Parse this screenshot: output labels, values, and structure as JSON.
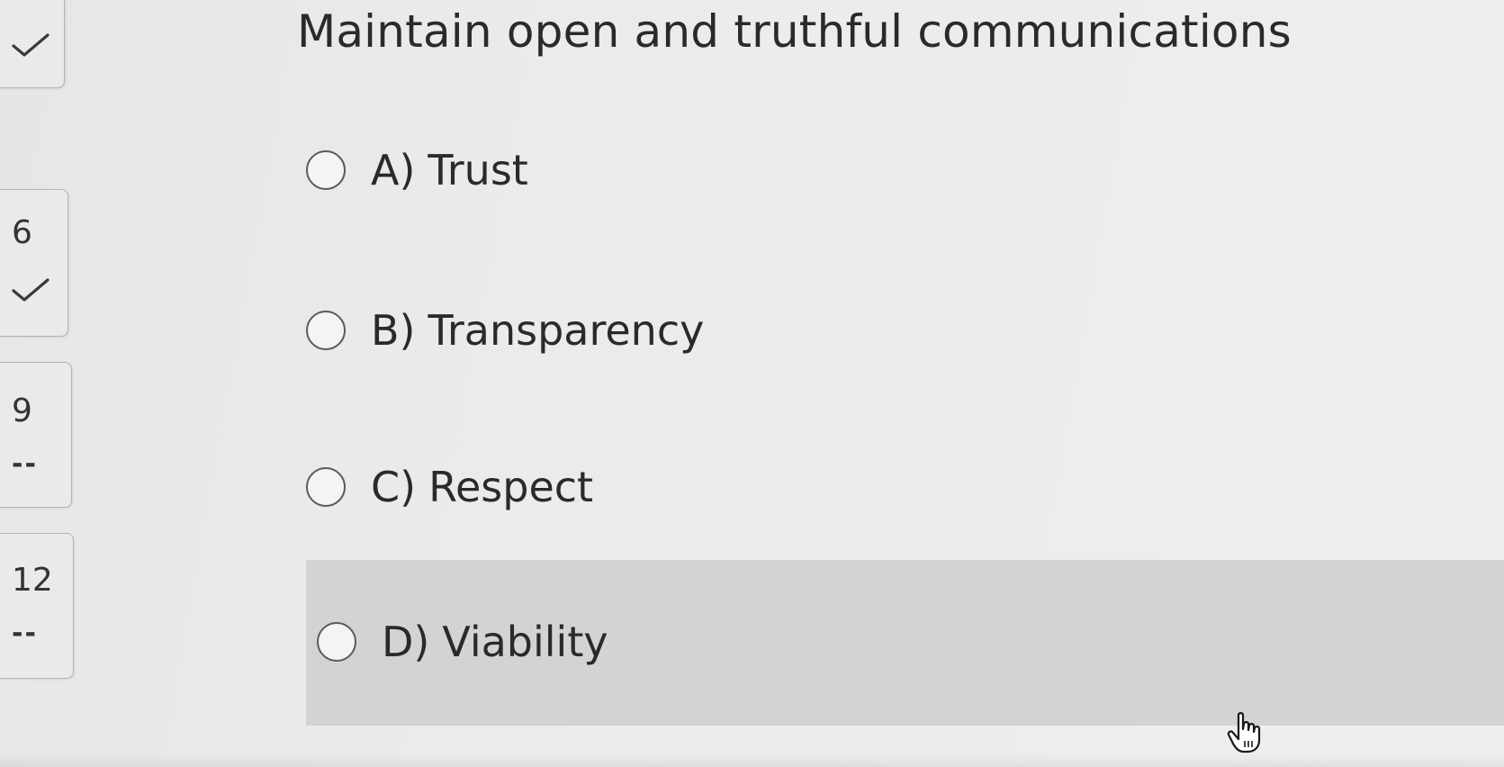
{
  "navigator": {
    "items": [
      {
        "number": "",
        "status": "answered",
        "status_icon": "check-icon"
      },
      {
        "number": "6",
        "status": "answered",
        "status_icon": "check-icon"
      },
      {
        "number": "9",
        "status": "unanswered",
        "status_text": "--"
      },
      {
        "number": "12",
        "status": "unanswered",
        "status_text": "--"
      }
    ]
  },
  "question": {
    "title": "Maintain open and truthful communications",
    "options": [
      {
        "letter": "A)",
        "text": "Trust",
        "selected": false
      },
      {
        "letter": "B)",
        "text": "Transparency",
        "selected": false
      },
      {
        "letter": "C)",
        "text": "Respect",
        "selected": false
      },
      {
        "letter": "D)",
        "text": "Viability",
        "selected": false,
        "hovered": true
      }
    ]
  },
  "colors": {
    "background": "#ebebeb",
    "hover_highlight": "#d3d3d3",
    "text": "#2a2a2a",
    "card_border": "#b4b4b4"
  },
  "cursor": {
    "icon": "hand-pointer-icon"
  }
}
